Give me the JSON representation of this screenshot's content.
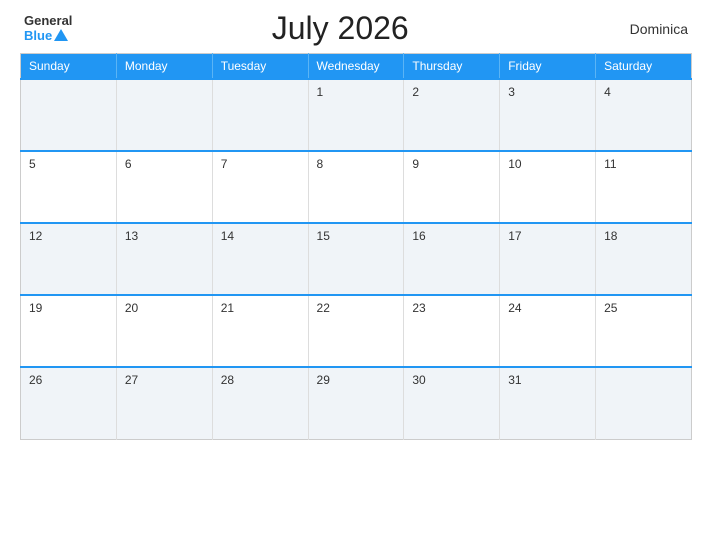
{
  "header": {
    "logo_general": "General",
    "logo_blue": "Blue",
    "title": "July 2026",
    "country": "Dominica"
  },
  "calendar": {
    "weekdays": [
      "Sunday",
      "Monday",
      "Tuesday",
      "Wednesday",
      "Thursday",
      "Friday",
      "Saturday"
    ],
    "weeks": [
      [
        null,
        null,
        null,
        1,
        2,
        3,
        4
      ],
      [
        5,
        6,
        7,
        8,
        9,
        10,
        11
      ],
      [
        12,
        13,
        14,
        15,
        16,
        17,
        18
      ],
      [
        19,
        20,
        21,
        22,
        23,
        24,
        25
      ],
      [
        26,
        27,
        28,
        29,
        30,
        31,
        null
      ]
    ]
  }
}
